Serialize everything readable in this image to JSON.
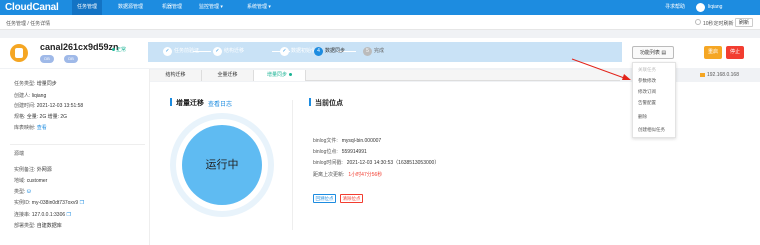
{
  "topnav": {
    "logo": "CloudCanal",
    "menus": [
      "任务管理",
      "数据源管理",
      "机器管理",
      "监控管理 ▾",
      "系统管理 ▾"
    ],
    "help": "寻求帮助",
    "user": "liqiang"
  },
  "subbar": {
    "breadcrumb": "任务管理 / 任务详情",
    "auto_refresh": "10秒定时刷新",
    "refresh": "刷新"
  },
  "task": {
    "name": "canal261cx9d59zn",
    "status": "正常",
    "tags": [
      "DB",
      "DB"
    ]
  },
  "steps": [
    {
      "num": "✓",
      "label": "任务前验证"
    },
    {
      "num": "✓",
      "label": "结构迁移"
    },
    {
      "num": "✓",
      "label": "数据初始化"
    },
    {
      "num": "4",
      "label": "数据同步"
    },
    {
      "num": "5",
      "label": "完成"
    }
  ],
  "actions": {
    "func_list": "功能列表",
    "restart": "重启",
    "stop": "停止"
  },
  "left": {
    "info": [
      {
        "k": "任务类型:",
        "v": "增量同步"
      },
      {
        "k": "创建人:",
        "v": "liqiang"
      },
      {
        "k": "创建时间:",
        "v": "2021-12-03 13:51:58"
      },
      {
        "k": "规格:",
        "v": "全量: 2G  增量: 2G"
      },
      {
        "k": "库表映射:",
        "v": "查看"
      }
    ],
    "source_title": "源端",
    "source": [
      {
        "k": "实例备注:",
        "v": "外网源"
      },
      {
        "k": "地域:",
        "v": "customer"
      },
      {
        "k": "类型:",
        "v": ""
      },
      {
        "k": "实例ID:",
        "v": "my-038in0dt737oxv9"
      },
      {
        "k": "连接串:",
        "v": "127.0.0.1:3306"
      },
      {
        "k": "部署类型:",
        "v": "自建数据库"
      }
    ]
  },
  "tabs": [
    "结构迁移",
    "全量迁移",
    "增量同步"
  ],
  "ip": "192.168.0.168",
  "incr": {
    "title": "增量迁移",
    "log_link": "查看日志",
    "state": "运行中"
  },
  "position": {
    "title": "当前位点",
    "rows": [
      {
        "k": "binlog文件:",
        "v": "mysql-bin.000007"
      },
      {
        "k": "binlog位点:",
        "v": "559914991"
      },
      {
        "k": "binlog时间戳:",
        "v": "2021-12-03 14:30:53（1638513053000）"
      },
      {
        "k": "距离上次更新:",
        "v": "1小时47分56秒"
      }
    ],
    "btn_back": "回溯位点",
    "btn_clear": "清除位点"
  },
  "dropdown": [
    "关联任务",
    "参数修改",
    "修改订阅",
    "告警配置",
    "删除",
    "创建相似任务"
  ],
  "colors": {
    "primary": "#1d8ce0",
    "accent": "#f5a623",
    "danger": "#f23d30",
    "ok": "#1ab394"
  }
}
